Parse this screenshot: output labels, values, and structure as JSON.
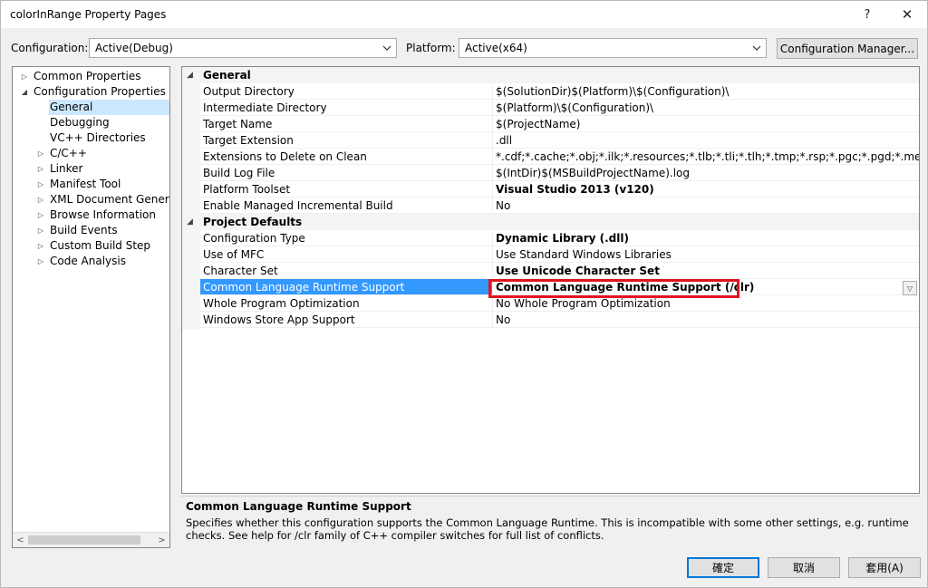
{
  "window": {
    "title": "colorInRange Property Pages",
    "help_glyph": "?",
    "close_glyph": "✕"
  },
  "config_bar": {
    "configuration_label": "Configuration:",
    "configuration_value": "Active(Debug)",
    "platform_label": "Platform:",
    "platform_value": "Active(x64)",
    "config_manager_label": "Configuration Manager..."
  },
  "tree": {
    "items": [
      {
        "label": "Common Properties",
        "expander": "▷",
        "level": 0
      },
      {
        "label": "Configuration Properties",
        "expander": "◢",
        "level": 0
      },
      {
        "label": "General",
        "expander": "",
        "level": 1,
        "selected": true
      },
      {
        "label": "Debugging",
        "expander": "",
        "level": 1
      },
      {
        "label": "VC++ Directories",
        "expander": "",
        "level": 1
      },
      {
        "label": "C/C++",
        "expander": "▷",
        "level": 1
      },
      {
        "label": "Linker",
        "expander": "▷",
        "level": 1
      },
      {
        "label": "Manifest Tool",
        "expander": "▷",
        "level": 1
      },
      {
        "label": "XML Document Generato",
        "expander": "▷",
        "level": 1
      },
      {
        "label": "Browse Information",
        "expander": "▷",
        "level": 1
      },
      {
        "label": "Build Events",
        "expander": "▷",
        "level": 1
      },
      {
        "label": "Custom Build Step",
        "expander": "▷",
        "level": 1
      },
      {
        "label": "Code Analysis",
        "expander": "▷",
        "level": 1
      }
    ],
    "scroll_left": "<",
    "scroll_right": ">"
  },
  "grid": {
    "categories": [
      {
        "label": "General",
        "expander": "◢",
        "rows": [
          {
            "name": "Output Directory",
            "value": "$(SolutionDir)$(Platform)\\$(Configuration)\\",
            "bold": false
          },
          {
            "name": "Intermediate Directory",
            "value": "$(Platform)\\$(Configuration)\\",
            "bold": false
          },
          {
            "name": "Target Name",
            "value": "$(ProjectName)",
            "bold": false
          },
          {
            "name": "Target Extension",
            "value": ".dll",
            "bold": false
          },
          {
            "name": "Extensions to Delete on Clean",
            "value": "*.cdf;*.cache;*.obj;*.ilk;*.resources;*.tlb;*.tli;*.tlh;*.tmp;*.rsp;*.pgc;*.pgd;*.meta;*.tlog;*.man",
            "bold": false
          },
          {
            "name": "Build Log File",
            "value": "$(IntDir)$(MSBuildProjectName).log",
            "bold": false
          },
          {
            "name": "Platform Toolset",
            "value": "Visual Studio 2013 (v120)",
            "bold": true
          },
          {
            "name": "Enable Managed Incremental Build",
            "value": "No",
            "bold": false
          }
        ]
      },
      {
        "label": "Project Defaults",
        "expander": "◢",
        "rows": [
          {
            "name": "Configuration Type",
            "value": "Dynamic Library (.dll)",
            "bold": true
          },
          {
            "name": "Use of MFC",
            "value": "Use Standard Windows Libraries",
            "bold": false
          },
          {
            "name": "Character Set",
            "value": "Use Unicode Character Set",
            "bold": true
          },
          {
            "name": "Common Language Runtime Support",
            "value": "Common Language Runtime Support (/clr)",
            "bold": true,
            "selected": true
          },
          {
            "name": "Whole Program Optimization",
            "value": "No Whole Program Optimization",
            "bold": false
          },
          {
            "name": "Windows Store App Support",
            "value": "No",
            "bold": false
          }
        ]
      }
    ],
    "dropdown_glyph": "▽"
  },
  "description": {
    "title": "Common Language Runtime Support",
    "text": "Specifies whether this configuration supports the Common Language Runtime. This is incompatible with some other settings, e.g. runtime checks. See help for /clr family of C++ compiler switches for full list of conflicts."
  },
  "buttons": {
    "ok": "確定",
    "cancel": "取消",
    "apply": "套用(A)"
  },
  "colors": {
    "selection": "#3399ff",
    "tree_selection": "#cce8ff",
    "highlight_box": "#e0141e"
  }
}
